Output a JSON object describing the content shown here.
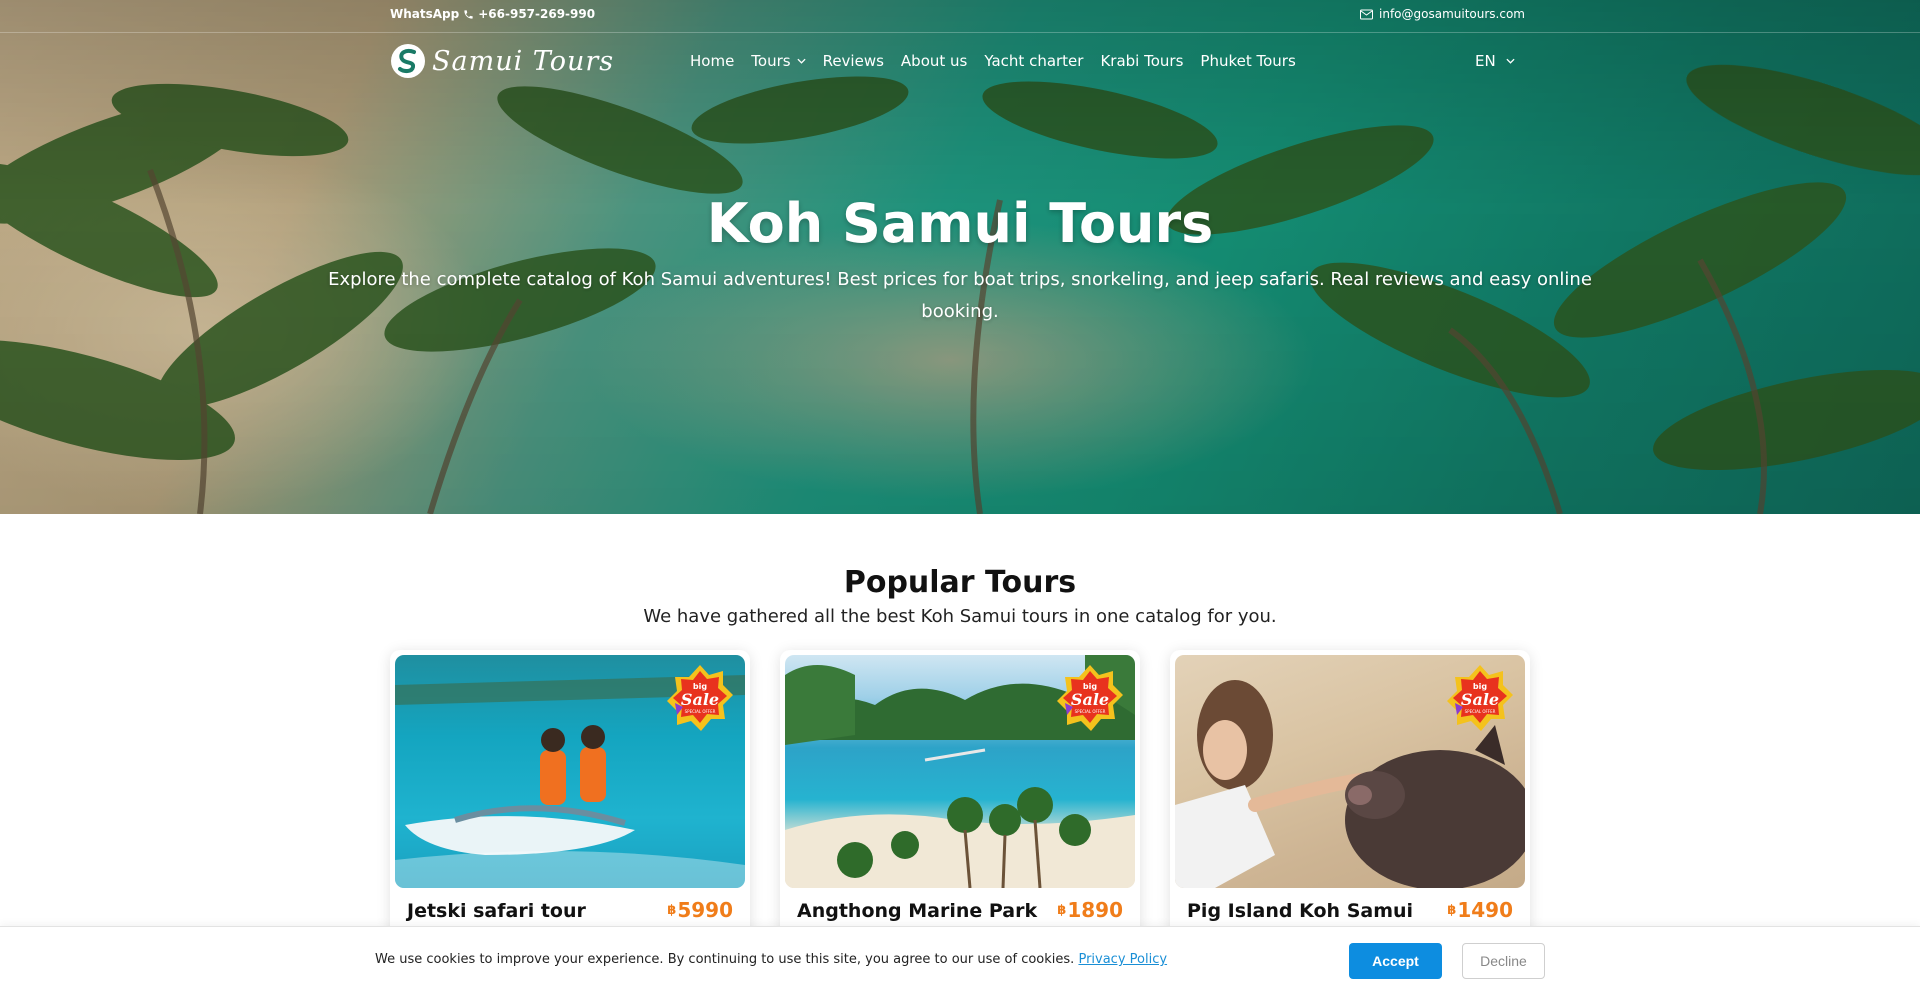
{
  "topbar": {
    "whatsapp_label": "WhatsApp",
    "phone": "+66-957-269-990",
    "email": "info@gosamuitours.com"
  },
  "header": {
    "logo_text": "Samui Tours",
    "nav": [
      "Home",
      "Tours",
      "Reviews",
      "About us",
      "Yacht charter",
      "Krabi Tours",
      "Phuket Tours"
    ],
    "language": "EN"
  },
  "hero": {
    "title": "Koh Samui Tours",
    "subtitle": "Explore the complete catalog of Koh Samui adventures! Best prices for boat trips, snorkeling, and jeep safaris. Real reviews and easy online booking."
  },
  "popular": {
    "title": "Popular Tours",
    "subtitle": "We have gathered all the best Koh Samui tours in one catalog for you.",
    "cards": [
      {
        "title": "Jetski safari tour",
        "currency": "฿",
        "price": "5990",
        "badge_top": "big",
        "badge_main": "Sale",
        "badge_sub": "SPECIAL OFFER"
      },
      {
        "title": "Angthong Marine Park",
        "currency": "฿",
        "price": "1890",
        "badge_top": "big",
        "badge_main": "Sale",
        "badge_sub": "SPECIAL OFFER"
      },
      {
        "title": "Pig Island Koh Samui",
        "currency": "฿",
        "price": "1490",
        "badge_top": "big",
        "badge_main": "Sale",
        "badge_sub": "SPECIAL OFFER"
      }
    ]
  },
  "cookie": {
    "text": "We use cookies to improve your experience. By continuing to use this site, you agree to our use of cookies.",
    "link": "Privacy Policy",
    "accept": "Accept",
    "decline": "Decline"
  },
  "colors": {
    "accent": "#0d8de0",
    "price": "#f07d1a",
    "hero_sea": "#169479"
  }
}
